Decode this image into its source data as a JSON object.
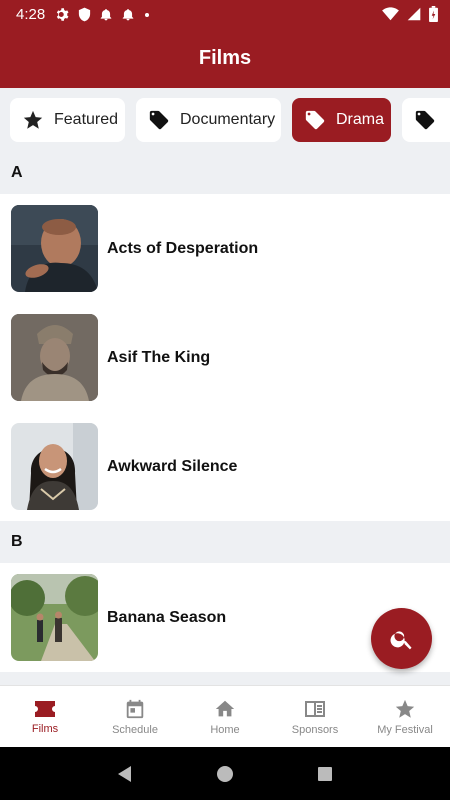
{
  "status_bar": {
    "time": "4:28"
  },
  "app_bar": {
    "title": "Films"
  },
  "chips": [
    {
      "label": "Featured",
      "icon": "star-icon"
    },
    {
      "label": "Documentary",
      "icon": "tag-icon"
    },
    {
      "label": "Drama",
      "icon": "tag-icon",
      "selected": true
    },
    {
      "label": "",
      "icon": "tag-icon"
    }
  ],
  "sections": [
    {
      "letter": "A",
      "films": [
        {
          "title": "Acts of Desperation"
        },
        {
          "title": "Asif The King"
        },
        {
          "title": "Awkward Silence"
        }
      ]
    },
    {
      "letter": "B",
      "films": [
        {
          "title": "Banana Season"
        }
      ]
    }
  ],
  "fab": {
    "icon": "search-icon"
  },
  "bottom_nav": [
    {
      "label": "Films",
      "icon": "ticket-icon",
      "active": true
    },
    {
      "label": "Schedule",
      "icon": "calendar-icon"
    },
    {
      "label": "Home",
      "icon": "home-icon"
    },
    {
      "label": "Sponsors",
      "icon": "sponsors-icon"
    },
    {
      "label": "My Festival",
      "icon": "star-icon"
    }
  ],
  "colors": {
    "primary": "#9a1c22",
    "background": "#eef0f3",
    "inactive": "#888888"
  }
}
